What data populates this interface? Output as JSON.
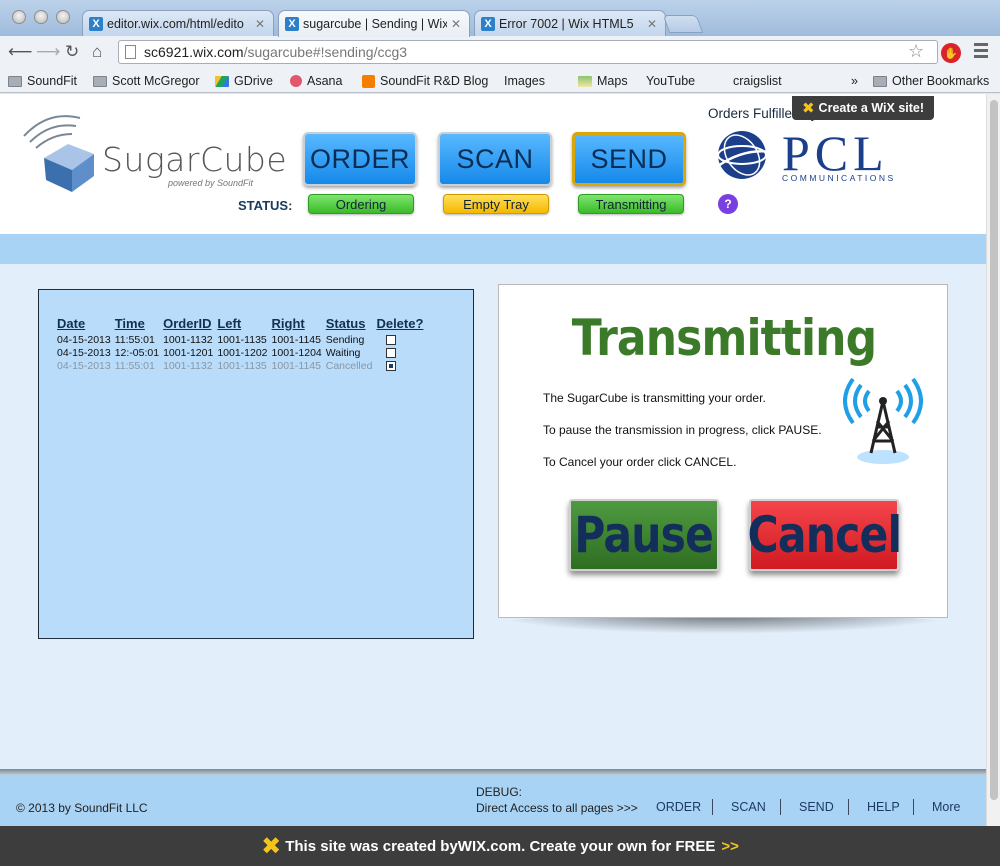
{
  "browser": {
    "tabs": [
      {
        "title": "editor.wix.com/html/edito",
        "active": false
      },
      {
        "title": "sugarcube | Sending | Wix",
        "active": true
      },
      {
        "title": "Error 7002 | Wix HTML5",
        "active": false
      }
    ],
    "url_host": "sc6921.wix.com",
    "url_path": "/sugarcube#!sending/ccg3",
    "bookmarks": [
      {
        "label": "SoundFit",
        "icon": "folder-icon"
      },
      {
        "label": "Scott McGregor",
        "icon": "folder-icon"
      },
      {
        "label": "GDrive",
        "icon": "drive-icon"
      },
      {
        "label": "Asana",
        "icon": "asana-icon"
      },
      {
        "label": "SoundFit R&D Blog",
        "icon": "blogger-icon"
      },
      {
        "label": "Images",
        "icon": "page-icon"
      },
      {
        "label": "Maps",
        "icon": "maps-icon"
      },
      {
        "label": "YouTube",
        "icon": "page-icon"
      },
      {
        "label": "craigslist",
        "icon": "page-icon"
      }
    ],
    "overflow": "»",
    "other_bookmarks": "Other Bookmarks"
  },
  "wix": {
    "promo_top": "Create a WiX site!",
    "promo_bottom_prefix": "This site was created by ",
    "promo_bottom_brand": "WIX.com",
    "promo_bottom_suffix": ". Create your own for FREE ",
    "promo_arrow": ">>"
  },
  "header": {
    "logo_text": "SugarCube",
    "logo_sub": "powered by SoundFit",
    "nav": [
      {
        "label": "ORDER",
        "current": false
      },
      {
        "label": "SCAN",
        "current": false
      },
      {
        "label": "SEND",
        "current": true
      }
    ],
    "status_label": "STATUS:",
    "status_pills": [
      {
        "label": "Ordering",
        "color": "#3bbb29"
      },
      {
        "label": "Empty Tray",
        "color": "#f5b800"
      },
      {
        "label": "Transmitting",
        "color": "#3bbb29"
      }
    ],
    "help": "?",
    "fulfilled_label": "Orders Fulfilled by:",
    "partner_name": "PCL",
    "partner_sub": "COMMUNICATIONS"
  },
  "orders": {
    "columns": [
      "Date",
      "Time",
      "OrderID",
      "Left",
      "Right",
      "Status",
      "Delete?"
    ],
    "rows": [
      {
        "date": "04-15-2013",
        "time": "11:55:01",
        "order_id": "1001-1132",
        "left": "1001-1135",
        "right": "1001-1145",
        "status": "Sending",
        "delete": false,
        "cancelled": false
      },
      {
        "date": "04-15-2013",
        "time": "12:-05:01",
        "order_id": "1001-1201",
        "left": "1001-1202",
        "right": "1001-1204",
        "status": "Waiting",
        "delete": false,
        "cancelled": false
      },
      {
        "date": "04-15-2013",
        "time": "11:55:01",
        "order_id": "1001-1132",
        "left": "1001-1135",
        "right": "1001-1145",
        "status": "Cancelled",
        "delete": true,
        "cancelled": true
      }
    ]
  },
  "sending": {
    "title": "Transmitting",
    "lines": [
      "The SugarCube is transmitting your order.",
      "To pause the transmission in progress, click PAUSE.",
      "To Cancel your order click CANCEL."
    ],
    "pause_label": "Pause",
    "cancel_label": "Cancel"
  },
  "footer": {
    "copyright": "© 2013 by SoundFit LLC",
    "debug": "DEBUG:",
    "direct": "Direct Access to all pages  >>>",
    "links": [
      "ORDER",
      "SCAN",
      "SEND",
      "HELP",
      "More"
    ]
  }
}
